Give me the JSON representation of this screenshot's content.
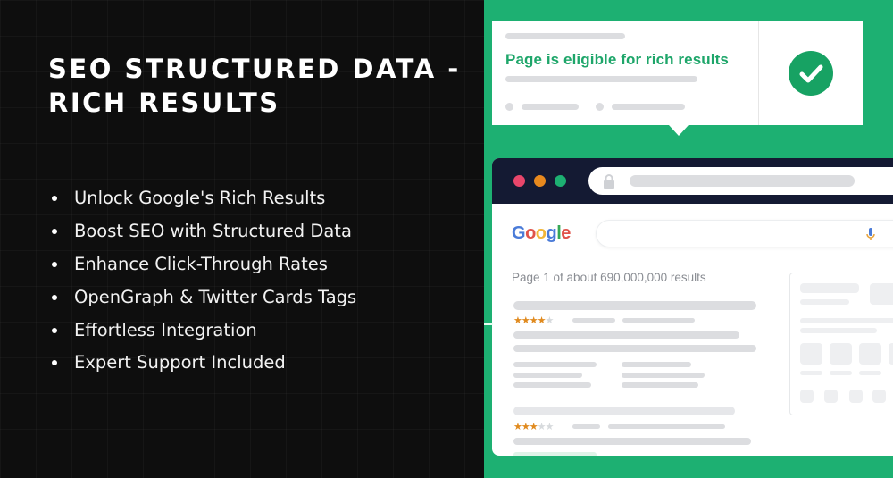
{
  "headline": {
    "line1": "SEO STRUCTURED DATA -",
    "line2": "RICH RESULTS"
  },
  "features": [
    "Unlock Google's Rich Results",
    "Boost SEO with Structured Data",
    "Enhance Click-Through Rates",
    "OpenGraph & Twitter Cards Tags",
    "Effortless Integration",
    "Expert Support Included"
  ],
  "rich_result_card": {
    "message": "Page is eligible for rich results",
    "status_icon": "check-circle-icon"
  },
  "browser": {
    "traffic_light_colors": [
      "#e8466b",
      "#e8891e",
      "#1db072"
    ],
    "logo_letters": [
      {
        "ch": "G",
        "color": "#4a7bd8"
      },
      {
        "ch": "o",
        "color": "#e0534a"
      },
      {
        "ch": "o",
        "color": "#f2b63a"
      },
      {
        "ch": "g",
        "color": "#4a7bd8"
      },
      {
        "ch": "l",
        "color": "#36a855"
      },
      {
        "ch": "e",
        "color": "#e0534a"
      }
    ],
    "result_count": "Page 1 of about 690,000,000 results",
    "results": [
      {
        "rating": 4,
        "max": 5
      },
      {
        "rating": 3,
        "max": 5
      }
    ]
  },
  "colors": {
    "background": "#0e0e0e",
    "accent": "#1db072",
    "message": "#1ea66a",
    "star": "#e08a1e",
    "browser_header": "#141a33"
  }
}
